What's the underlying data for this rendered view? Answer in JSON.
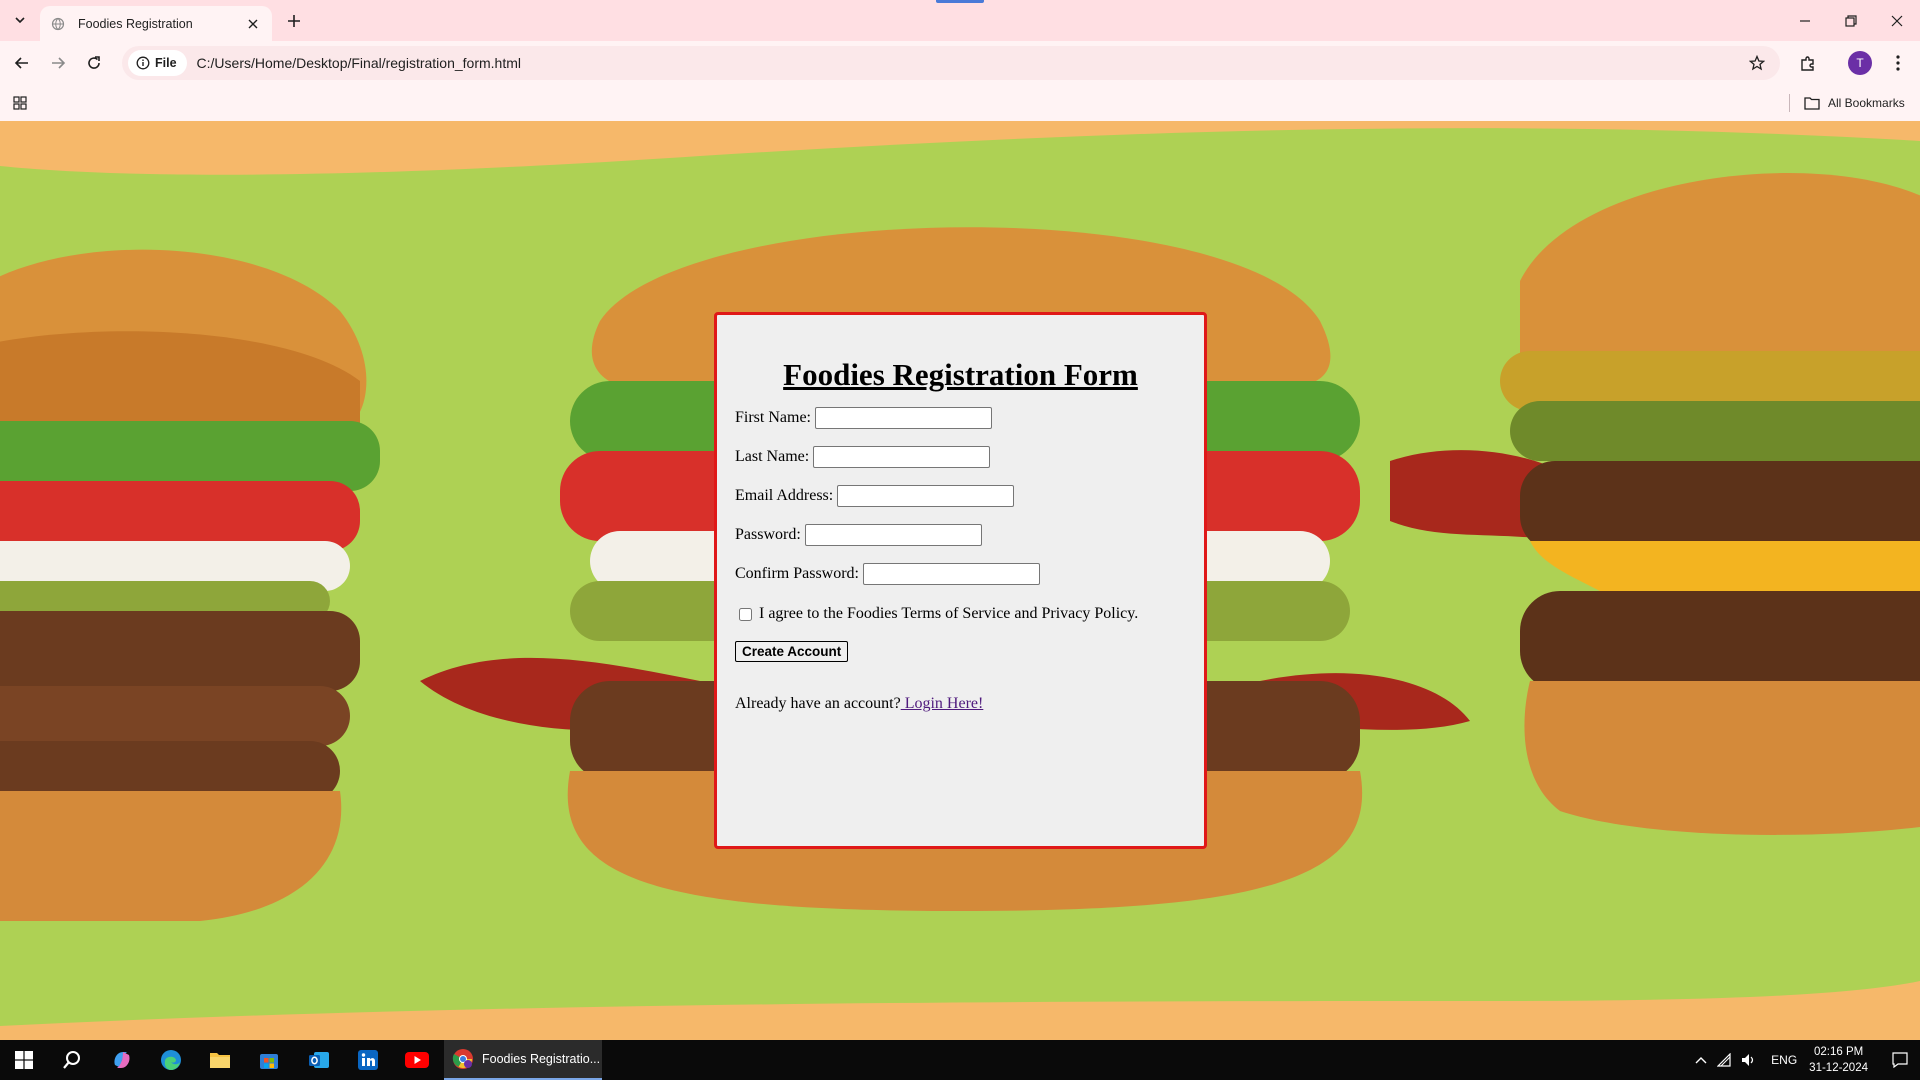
{
  "browser": {
    "tab_title": "Foodies Registration",
    "site_chip": "File",
    "url": "C:/Users/Home/Desktop/Final/registration_form.html",
    "profile_initial": "T",
    "all_bookmarks": "All Bookmarks",
    "icons": {
      "tab_list": "chevron-down-icon",
      "favicon": "globe-icon",
      "close": "close-icon",
      "new_tab": "plus-icon",
      "back": "back-arrow-icon",
      "forward": "forward-arrow-icon",
      "reload": "reload-icon",
      "info": "info-icon",
      "star": "star-icon",
      "extensions": "puzzle-icon",
      "menu": "kebab-menu-icon",
      "apps": "apps-grid-icon",
      "folder": "folder-icon"
    }
  },
  "form": {
    "title": "Foodies Registration Form",
    "first_name_label": "First Name:",
    "last_name_label": "Last Name:",
    "email_label": "Email Address:",
    "password_label": "Password:",
    "confirm_password_label": "Confirm Password:",
    "first_name_value": "",
    "last_name_value": "",
    "email_value": "",
    "password_value": "",
    "confirm_password_value": "",
    "terms_label": "I agree to the Foodies Terms of Service and Privacy Policy.",
    "terms_checked": false,
    "submit_label": "Create Account",
    "login_prompt": "Already have an account?",
    "login_link": " Login Here!",
    "border_color": "#e01818",
    "background_color": "#efefef"
  },
  "page": {
    "background_color": "#aed154",
    "background_art": "burger-hero-image"
  },
  "taskbar": {
    "active_window_label": "Foodies Registratio...",
    "language": "ENG",
    "time": "02:16 PM",
    "date": "31-12-2024",
    "pinned_icons": [
      "windows-start-icon",
      "search-icon",
      "copilot-icon",
      "edge-icon",
      "file-explorer-icon",
      "microsoft-store-icon",
      "outlook-icon",
      "linkedin-icon",
      "youtube-icon"
    ]
  }
}
